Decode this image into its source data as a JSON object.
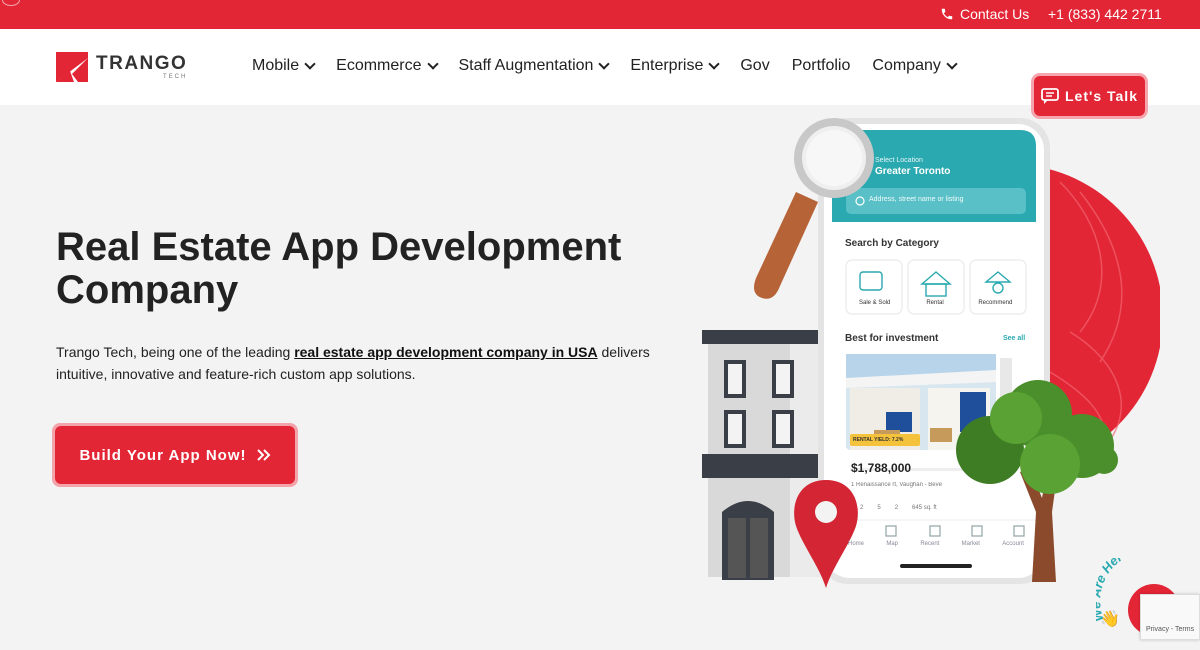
{
  "topbar": {
    "contact_label": "Contact Us",
    "phone": "+1 (833) 442 2711"
  },
  "logo": {
    "name": "TRANGO",
    "sub": "TECH"
  },
  "nav": {
    "items": [
      {
        "label": "Mobile",
        "dropdown": true
      },
      {
        "label": "Ecommerce",
        "dropdown": true
      },
      {
        "label": "Staff Augmentation",
        "dropdown": true
      },
      {
        "label": "Enterprise",
        "dropdown": true
      },
      {
        "label": "Gov",
        "dropdown": false
      },
      {
        "label": "Portfolio",
        "dropdown": false
      },
      {
        "label": "Company",
        "dropdown": true
      }
    ],
    "cta_label": "Let's Talk"
  },
  "hero": {
    "title": "Real Estate App Development Company",
    "desc_before": "Trango Tech, being one of the leading ",
    "desc_link": "real estate app development company in USA",
    "desc_after": " delivers intuitive, innovative and feature-rich custom app solutions.",
    "cta_label": "Build Your App Now!"
  },
  "phone_app": {
    "location_caption": "Select Location",
    "location": "Greater Toronto",
    "search_placeholder": "Address, street name or listing",
    "category_title": "Search by Category",
    "categories": [
      "Sale & Sold",
      "Rental",
      "Recommend"
    ],
    "section_title": "Best for investment",
    "see_all": "See all",
    "badge": "RENTAL YIELD: 7.2%",
    "price": "$1,788,000",
    "address": "1 Renaissance rt, Vaughan - Beve",
    "specs": [
      "2",
      "5",
      "2",
      "645 sq. ft"
    ],
    "tabs": [
      "Home",
      "Map",
      "Recent",
      "Market",
      "Account"
    ]
  },
  "chat": {
    "arc_text": "We Are Here!"
  },
  "recaptcha": {
    "text": "Privacy - Terms"
  },
  "colors": {
    "brand_red": "#e32636",
    "teal": "#2aa9b0",
    "background": "#f3f3f3"
  }
}
